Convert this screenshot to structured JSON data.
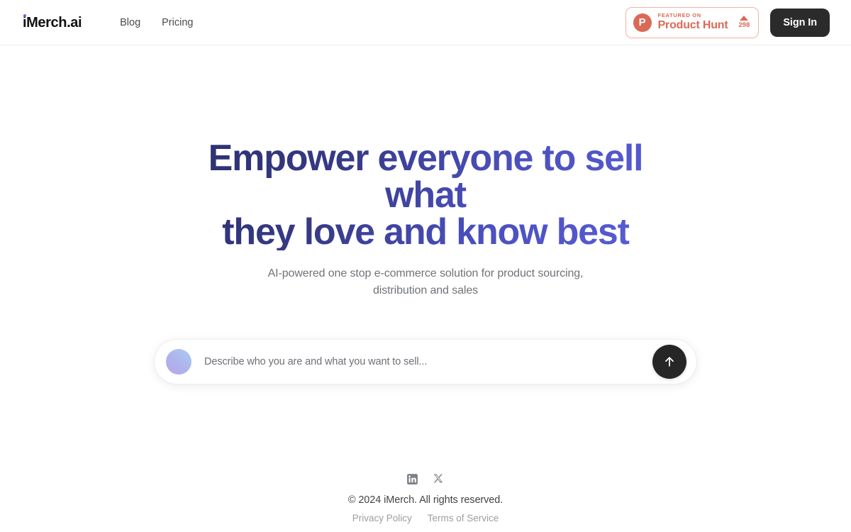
{
  "header": {
    "logo": "iMerch.ai",
    "nav": [
      {
        "label": "Blog"
      },
      {
        "label": "Pricing"
      }
    ],
    "product_hunt": {
      "icon_letter": "P",
      "featured_label": "FEATURED ON",
      "name": "Product Hunt",
      "upvotes": "298",
      "accent_color": "#da6a56"
    },
    "sign_in_label": "Sign In"
  },
  "hero": {
    "headline_line1": "Empower everyone to sell what",
    "headline_line2": "they love and know best",
    "subtitle": "AI-powered one stop e-commerce solution for product sourcing, distribution and sales",
    "gradient_from": "#2d2f6e",
    "gradient_to": "#5a5fd8"
  },
  "prompt": {
    "placeholder": "Describe who you are and what you want to sell...",
    "value": "",
    "submit_icon": "arrow-up-icon",
    "avatar_gradient_from": "#b6a6e8",
    "avatar_gradient_to": "#a9cdf2"
  },
  "footer": {
    "socials": [
      {
        "name": "linkedin-icon"
      },
      {
        "name": "x-twitter-icon"
      }
    ],
    "copyright": "© 2024 iMerch. All rights reserved.",
    "links": [
      {
        "label": "Privacy Policy"
      },
      {
        "label": "Terms of Service"
      }
    ]
  }
}
